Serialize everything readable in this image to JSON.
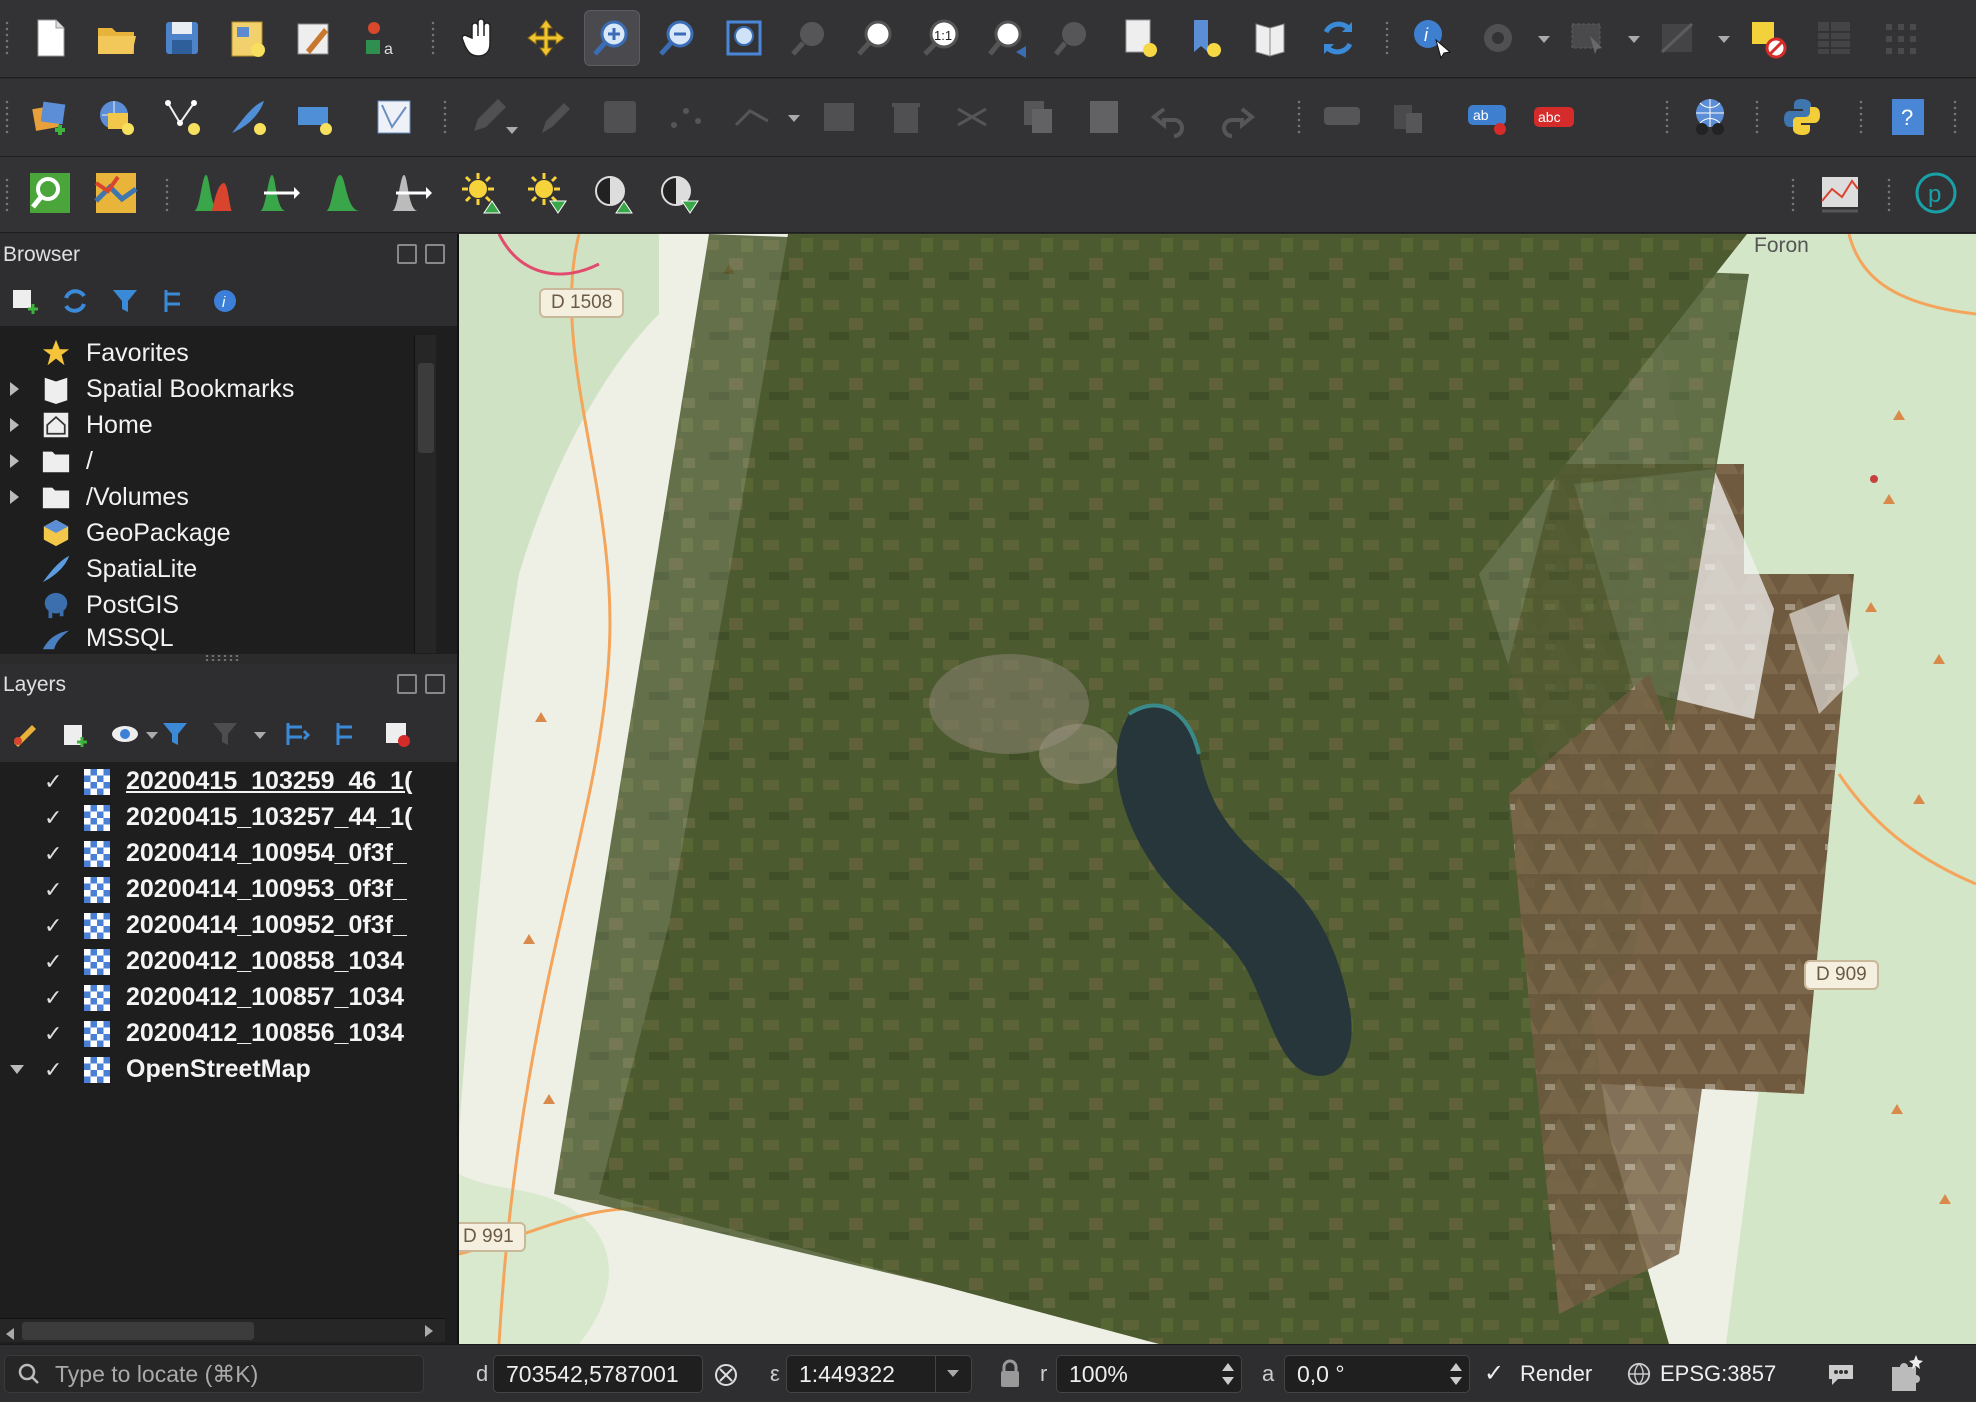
{
  "toolbar1": {
    "icons": [
      "new-project",
      "open-project",
      "save-project",
      "new-print-layout",
      "layout-manager",
      "style-manager",
      "pan",
      "pan-to-selection",
      "zoom-in",
      "zoom-out",
      "zoom-full",
      "zoom-to-selection",
      "zoom-to-layer",
      "zoom-native",
      "zoom-last",
      "zoom-next",
      "new-bookmark",
      "show-bookmarks",
      "show-spatial-bookmarks",
      "refresh",
      "identify",
      "run-feature-action",
      "select-features",
      "deselect-all",
      "attribute-table",
      "statistics"
    ]
  },
  "toolbar2": {
    "icons": [
      "data-source-manager",
      "new-geopackage-layer",
      "new-shapefile-layer",
      "new-spatialite-layer",
      "new-virtual-layer",
      "digitize-shape",
      "current-edits",
      "toggle-editing",
      "save-edits",
      "digitize",
      "vertex-tool",
      "modify-attributes",
      "delete-selected",
      "cut",
      "copy",
      "paste",
      "undo",
      "redo",
      "label-tool",
      "pin-labels",
      "layer-labeling",
      "show-labels",
      "quickmapservices",
      "python-console",
      "help"
    ]
  },
  "toolbar3": {
    "icons": [
      "locate",
      "georeferencer",
      "histogram",
      "histogram-stretch",
      "local-histogram",
      "local-stretch",
      "brightness-increase",
      "brightness-decrease",
      "contrast-increase",
      "contrast-decrease",
      "profile-tool",
      "plugin-p"
    ]
  },
  "browser": {
    "title": "Browser",
    "items": [
      {
        "label": "Favorites",
        "icon": "star-icon",
        "expandable": false
      },
      {
        "label": "Spatial Bookmarks",
        "icon": "bookmark-icon",
        "expandable": true
      },
      {
        "label": "Home",
        "icon": "home-icon",
        "expandable": true
      },
      {
        "label": "/",
        "icon": "folder-icon",
        "expandable": true
      },
      {
        "label": "/Volumes",
        "icon": "folder-icon",
        "expandable": true
      },
      {
        "label": "GeoPackage",
        "icon": "geopackage-icon",
        "expandable": false
      },
      {
        "label": "SpatiaLite",
        "icon": "spatialite-icon",
        "expandable": false
      },
      {
        "label": "PostGIS",
        "icon": "postgis-icon",
        "expandable": false
      },
      {
        "label": "MSSQL",
        "icon": "mssql-icon",
        "expandable": false
      }
    ]
  },
  "layers": {
    "title": "Layers",
    "items": [
      {
        "name": "20200415_103259_46_1(",
        "checked": "✓",
        "selected": true
      },
      {
        "name": "20200415_103257_44_1(",
        "checked": "✓"
      },
      {
        "name": "20200414_100954_0f3f_",
        "checked": "✓"
      },
      {
        "name": "20200414_100953_0f3f_",
        "checked": "✓"
      },
      {
        "name": "20200414_100952_0f3f_",
        "checked": "✓"
      },
      {
        "name": "20200412_100858_1034",
        "checked": "✓"
      },
      {
        "name": "20200412_100857_1034",
        "checked": "✓"
      },
      {
        "name": "20200412_100856_1034",
        "checked": "✓"
      },
      {
        "name": "OpenStreetMap",
        "checked": "✓",
        "expanded": true
      }
    ]
  },
  "map": {
    "road_labels": [
      "D 1508",
      "D 909",
      "D 991"
    ],
    "place_labels": [
      "Foron"
    ],
    "colors": {
      "base": "#eef0e6",
      "forest": "#cfe3c4",
      "water": "#aad3df",
      "imagery": "#4c5a2f"
    }
  },
  "status": {
    "locate_placeholder": "Type to locate (⌘K)",
    "coordinate_label": "d",
    "coordinate": "703542,5787001",
    "scale_label": "ε",
    "scale": "1:449322",
    "magnifier_label": "r",
    "magnifier": "100%",
    "rotation_label": "a",
    "rotation": "0,0 °",
    "render_check": "✓",
    "render_label": "Render",
    "crs": "EPSG:3857"
  }
}
